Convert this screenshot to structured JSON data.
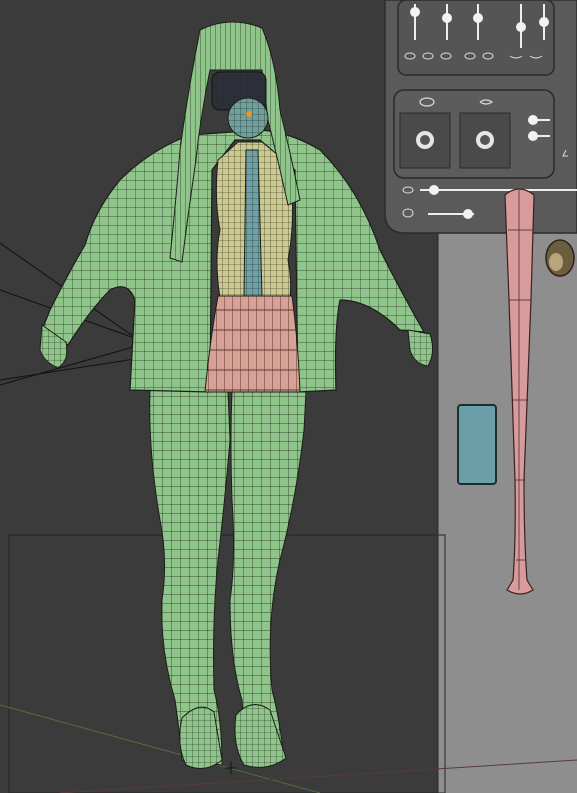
{
  "viewport": {
    "background": "#3b3b3b",
    "right_panel_background": "#8f8f8f",
    "mesh_color": "#8fc48a",
    "wire_color": "#1a1f18",
    "skirt_color": "#d8a196",
    "shirt_color": "#cdc98f",
    "tie_color": "#6fa2a8",
    "bat_color": "#d79b9b",
    "phone_color": "#6a9fa8"
  },
  "rig_panel": {
    "sliders_top_count": 5,
    "preview_buttons": [
      "eye-preview-left",
      "eye-preview-right"
    ],
    "face_icons": [
      "eye-icon",
      "mouth-icon",
      "brow-icon",
      "nose-icon"
    ]
  },
  "objects": [
    "character-mesh",
    "baseball-bat",
    "phone-prop",
    "ground-grid"
  ]
}
